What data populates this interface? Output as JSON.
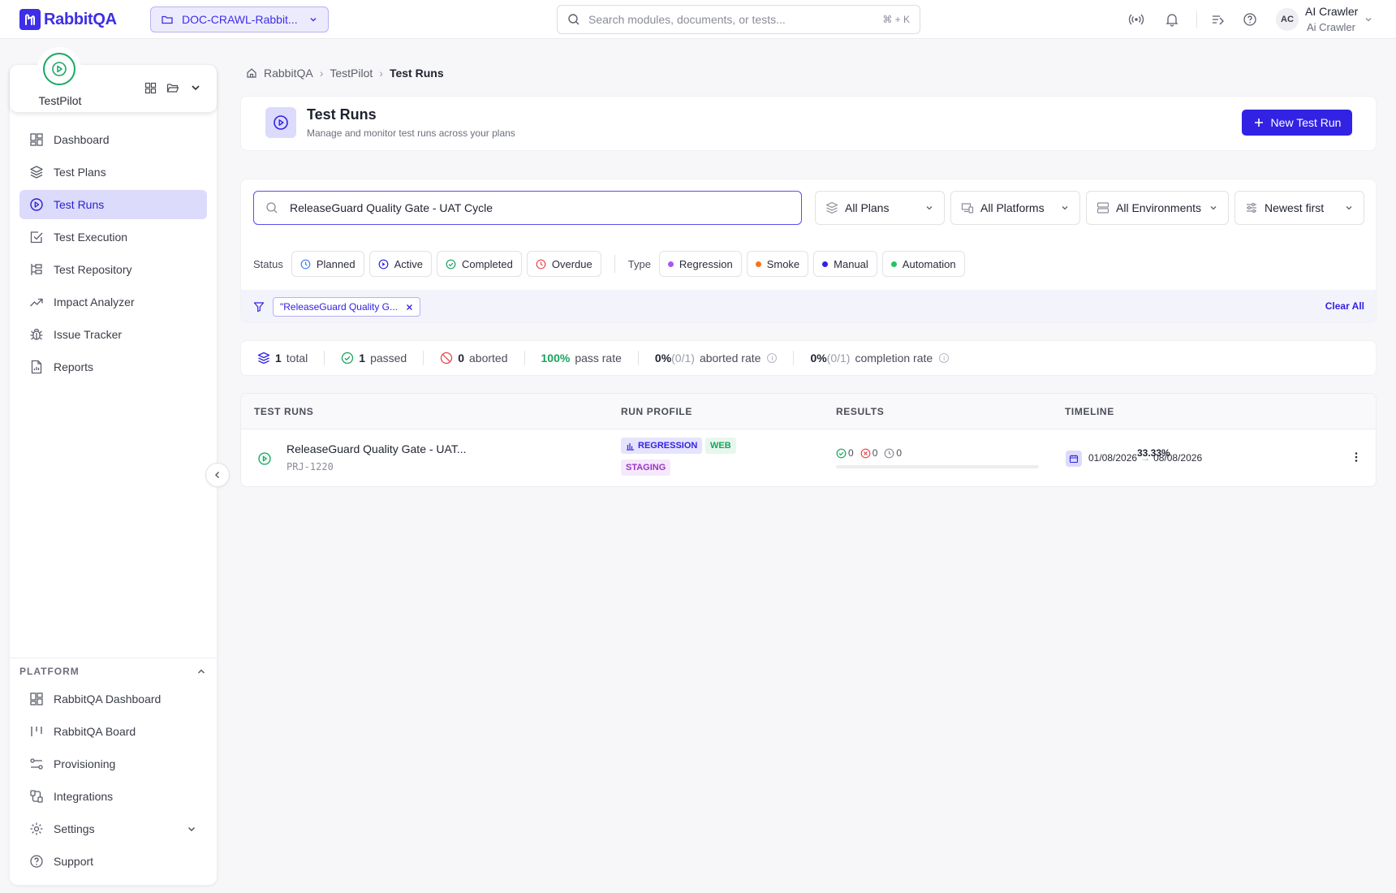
{
  "app": {
    "logo_text": "RabbitQA",
    "brand_color": "#3d2ee8"
  },
  "project": {
    "name": "DOC-CRAWL-Rabbit..."
  },
  "global_search": {
    "placeholder": "Search modules, documents, or tests...",
    "shortcut": "⌘ + K"
  },
  "user": {
    "initials": "AC",
    "name": "AI Crawler",
    "role": "Ai Crawler"
  },
  "module": {
    "name": "TestPilot"
  },
  "sidebar": {
    "items": [
      {
        "label": "Dashboard",
        "icon": "dashboard-icon"
      },
      {
        "label": "Test Plans",
        "icon": "layers-icon"
      },
      {
        "label": "Test Runs",
        "icon": "play-circle-icon",
        "active": true
      },
      {
        "label": "Test Execution",
        "icon": "checkbox-icon"
      },
      {
        "label": "Test Repository",
        "icon": "tree-icon"
      },
      {
        "label": "Impact Analyzer",
        "icon": "trend-icon"
      },
      {
        "label": "Issue Tracker",
        "icon": "bug-icon"
      },
      {
        "label": "Reports",
        "icon": "report-icon"
      }
    ],
    "platform_heading": "PLATFORM",
    "platform_items": [
      {
        "label": "RabbitQA Dashboard",
        "icon": "dashboard-icon"
      },
      {
        "label": "RabbitQA Board",
        "icon": "board-icon"
      },
      {
        "label": "Provisioning",
        "icon": "provisioning-icon"
      },
      {
        "label": "Integrations",
        "icon": "integrations-icon"
      },
      {
        "label": "Settings",
        "icon": "gear-icon"
      },
      {
        "label": "Support",
        "icon": "help-icon"
      }
    ]
  },
  "breadcrumb": [
    "RabbitQA",
    "TestPilot",
    "Test Runs"
  ],
  "page": {
    "title": "Test Runs",
    "subtitle": "Manage and monitor test runs across your plans",
    "new_button": "New Test Run"
  },
  "filters": {
    "search_value": "ReleaseGuard Quality Gate - UAT Cycle",
    "plans": "All Plans",
    "platforms": "All Platforms",
    "environments": "All Environments",
    "sort": "Newest first",
    "status_label": "Status",
    "statuses": [
      "Planned",
      "Active",
      "Completed",
      "Overdue"
    ],
    "type_label": "Type",
    "types": [
      {
        "label": "Regression",
        "color": "#a855f7"
      },
      {
        "label": "Smoke",
        "color": "#f97316"
      },
      {
        "label": "Manual",
        "color": "#3122e4"
      },
      {
        "label": "Automation",
        "color": "#22c55e"
      }
    ],
    "active_filter": "\"ReleaseGuard Quality G...",
    "clear_all": "Clear All"
  },
  "stats": {
    "total": "1",
    "total_label": "total",
    "passed": "1",
    "passed_label": "passed",
    "aborted": "0",
    "aborted_label": "aborted",
    "pass_rate": "100%",
    "pass_rate_label": "pass rate",
    "aborted_rate": "0%",
    "aborted_rate_frac": "(0/1)",
    "aborted_rate_label": "aborted rate",
    "completion_rate": "0%",
    "completion_rate_frac": "(0/1)",
    "completion_rate_label": "completion rate"
  },
  "table": {
    "headers": [
      "TEST RUNS",
      "RUN PROFILE",
      "RESULTS",
      "TIMELINE"
    ],
    "rows": [
      {
        "title": "ReleaseGuard Quality Gate - UAT...",
        "id": "PRJ-1220",
        "tags": [
          "REGRESSION",
          "WEB",
          "STAGING"
        ],
        "passed": "0",
        "failed": "0",
        "pending": "0",
        "percent": "33.33%",
        "progress": 0,
        "start": "01/08/2026",
        "end": "08/08/2026"
      }
    ]
  }
}
